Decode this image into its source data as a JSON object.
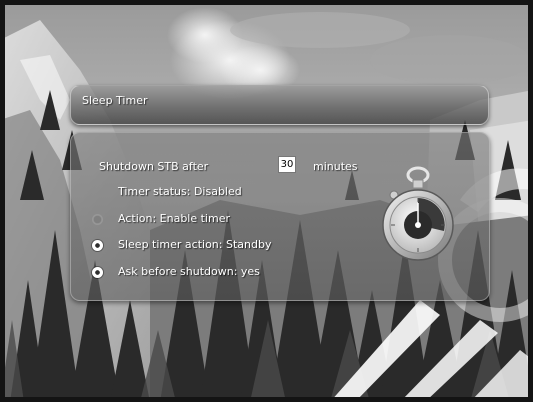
{
  "dialog": {
    "title": "Sleep Timer"
  },
  "settings": {
    "shutdown_label": "Shutdown STB after",
    "shutdown_value": "30",
    "shutdown_unit": "minutes",
    "timer_status": "Timer status: Disabled",
    "options": [
      {
        "label": "Action: Enable timer",
        "selected": false
      },
      {
        "label": "Sleep timer action: Standby",
        "selected": true
      },
      {
        "label": "Ask before shutdown: yes",
        "selected": true
      }
    ]
  },
  "icons": {
    "stopwatch": "stopwatch-icon",
    "radio": "radio-button-icon"
  },
  "colors": {
    "text": "#ffffff",
    "panel": "#7a7a7a",
    "value_box": "#ffffff"
  }
}
